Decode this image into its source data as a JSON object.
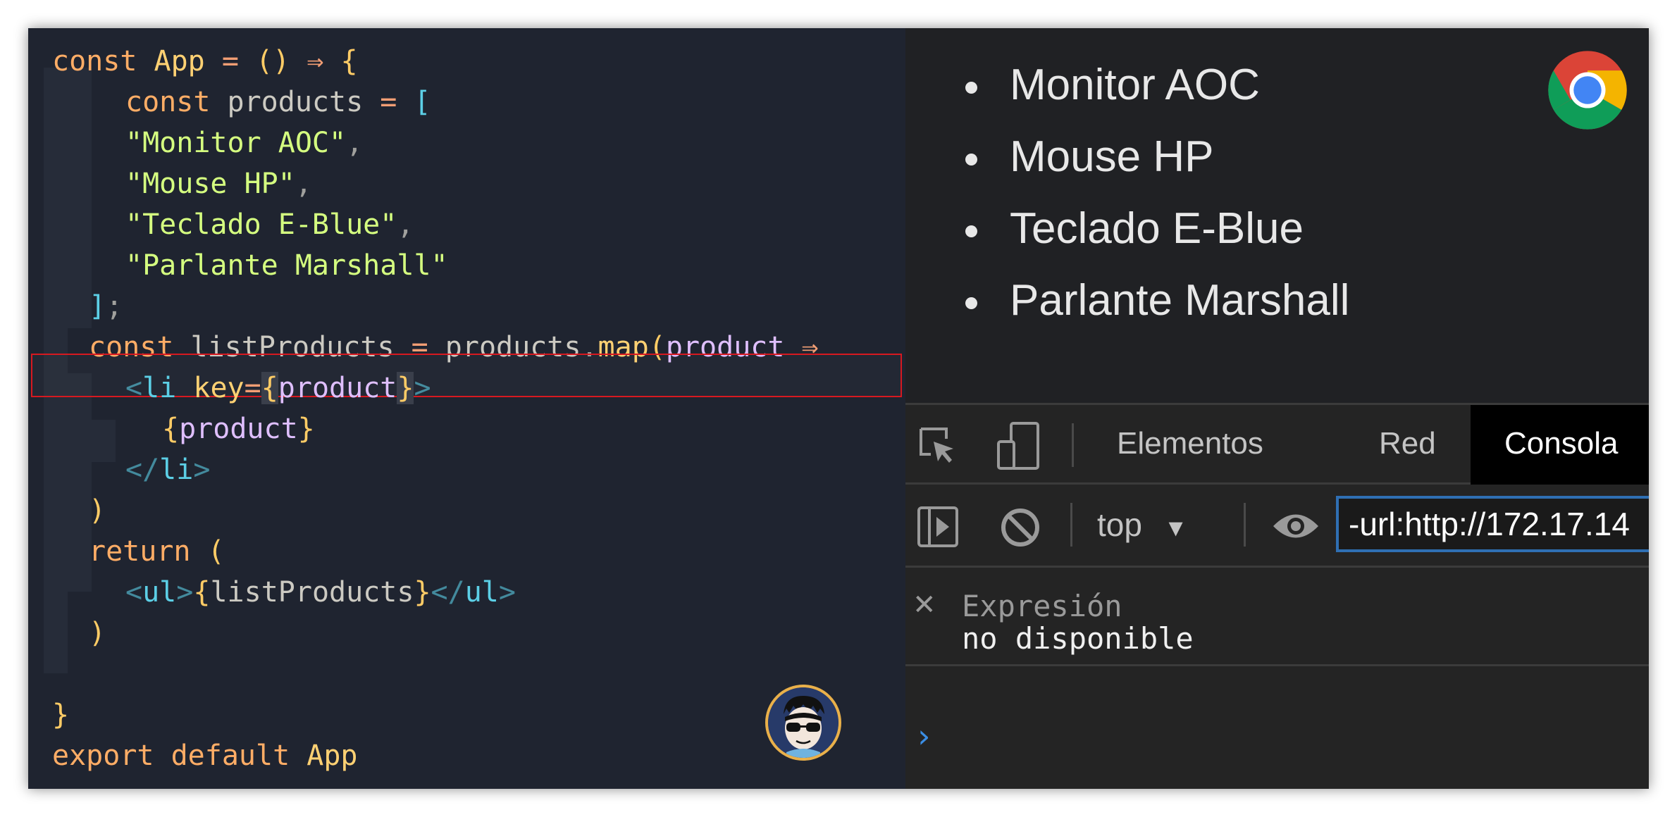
{
  "editor": {
    "lines": [
      "const App = () ⇒ {",
      "const products = [",
      "\"Monitor AOC\"",
      "\"Mouse HP\"",
      "\"Teclado E-Blue\"",
      "\"Parlante Marshall\"",
      "];",
      "const listProducts = products.map(product ⇒",
      "<li key={product}>",
      "{product}",
      "</li>",
      ")",
      "return (",
      "<ul>{listProducts}</ul>",
      ")",
      "}",
      "export default App"
    ]
  },
  "browser": {
    "products": [
      "Monitor AOC",
      "Mouse HP",
      "Teclado E-Blue",
      "Parlante Marshall"
    ],
    "devtools": {
      "tabs": [
        "Elementos",
        "Red",
        "Consola"
      ],
      "active_tab": "Consola",
      "context": "top",
      "filter_value": "-url:http://172.17.14",
      "expression_label": "Expresión",
      "expression_value": "no disponible",
      "prompt": "›"
    }
  },
  "colors": {
    "editor_bg": "#1f2430",
    "highlight_border": "#d71920",
    "devtools_bg": "#242424",
    "active_tab_bg": "#000000",
    "filter_border": "#2f6fb3"
  }
}
